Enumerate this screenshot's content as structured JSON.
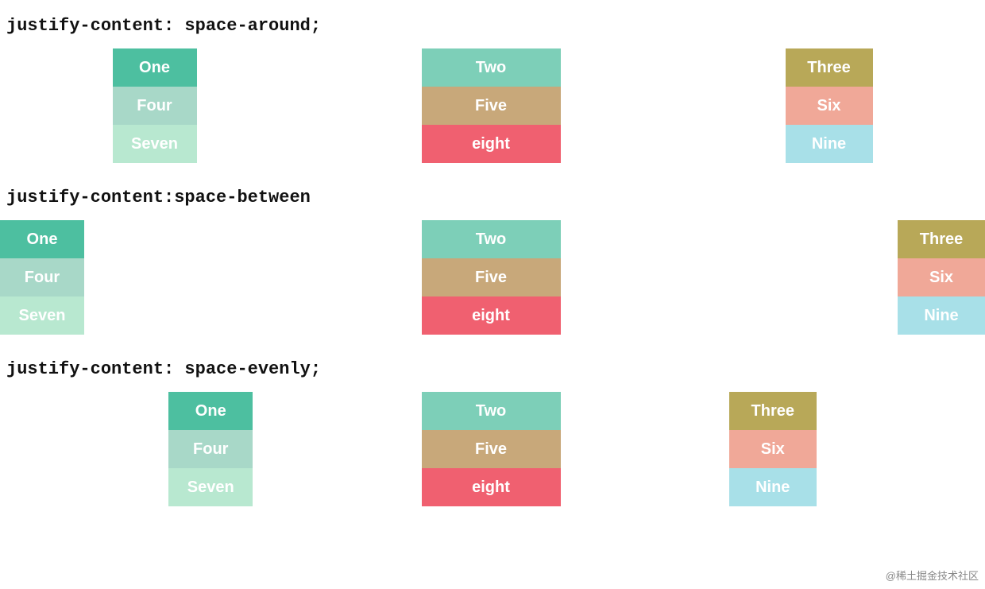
{
  "sections": [
    {
      "id": "space-around",
      "label": "justify-content: space-around;",
      "justify": "space-around",
      "columns": [
        {
          "id": "col1",
          "items": [
            {
              "label": "One",
              "color": "green-dark"
            },
            {
              "label": "Four",
              "color": "green-light"
            },
            {
              "label": "Seven",
              "color": "green-pale"
            }
          ]
        },
        {
          "id": "col2",
          "items": [
            {
              "label": "Two",
              "color": "green-mid"
            },
            {
              "label": "Five",
              "color": "tan"
            },
            {
              "label": "eight",
              "color": "red"
            }
          ]
        },
        {
          "id": "col3",
          "items": [
            {
              "label": "Three",
              "color": "olive"
            },
            {
              "label": "Six",
              "color": "pink-light"
            },
            {
              "label": "Nine",
              "color": "cyan-light"
            }
          ]
        }
      ]
    },
    {
      "id": "space-between",
      "label": "justify-content:space-between",
      "justify": "space-between",
      "columns": [
        {
          "id": "col1",
          "items": [
            {
              "label": "One",
              "color": "green-dark"
            },
            {
              "label": "Four",
              "color": "green-light"
            },
            {
              "label": "Seven",
              "color": "green-pale"
            }
          ]
        },
        {
          "id": "col2",
          "items": [
            {
              "label": "Two",
              "color": "green-mid"
            },
            {
              "label": "Five",
              "color": "tan"
            },
            {
              "label": "eight",
              "color": "red"
            }
          ]
        },
        {
          "id": "col3",
          "items": [
            {
              "label": "Three",
              "color": "olive"
            },
            {
              "label": "Six",
              "color": "pink-light"
            },
            {
              "label": "Nine",
              "color": "cyan-light"
            }
          ]
        }
      ]
    },
    {
      "id": "space-evenly",
      "label": "justify-content: space-evenly;",
      "justify": "space-evenly",
      "columns": [
        {
          "id": "col1",
          "items": [
            {
              "label": "One",
              "color": "green-dark"
            },
            {
              "label": "Four",
              "color": "green-light"
            },
            {
              "label": "Seven",
              "color": "green-pale"
            }
          ]
        },
        {
          "id": "col2",
          "items": [
            {
              "label": "Two",
              "color": "green-mid"
            },
            {
              "label": "Five",
              "color": "tan"
            },
            {
              "label": "eight",
              "color": "red"
            }
          ]
        },
        {
          "id": "col3",
          "items": [
            {
              "label": "Three",
              "color": "olive"
            },
            {
              "label": "Six",
              "color": "pink-light"
            },
            {
              "label": "Nine",
              "color": "cyan-light"
            }
          ]
        }
      ]
    }
  ],
  "watermark": "@稀土掘金技术社区"
}
